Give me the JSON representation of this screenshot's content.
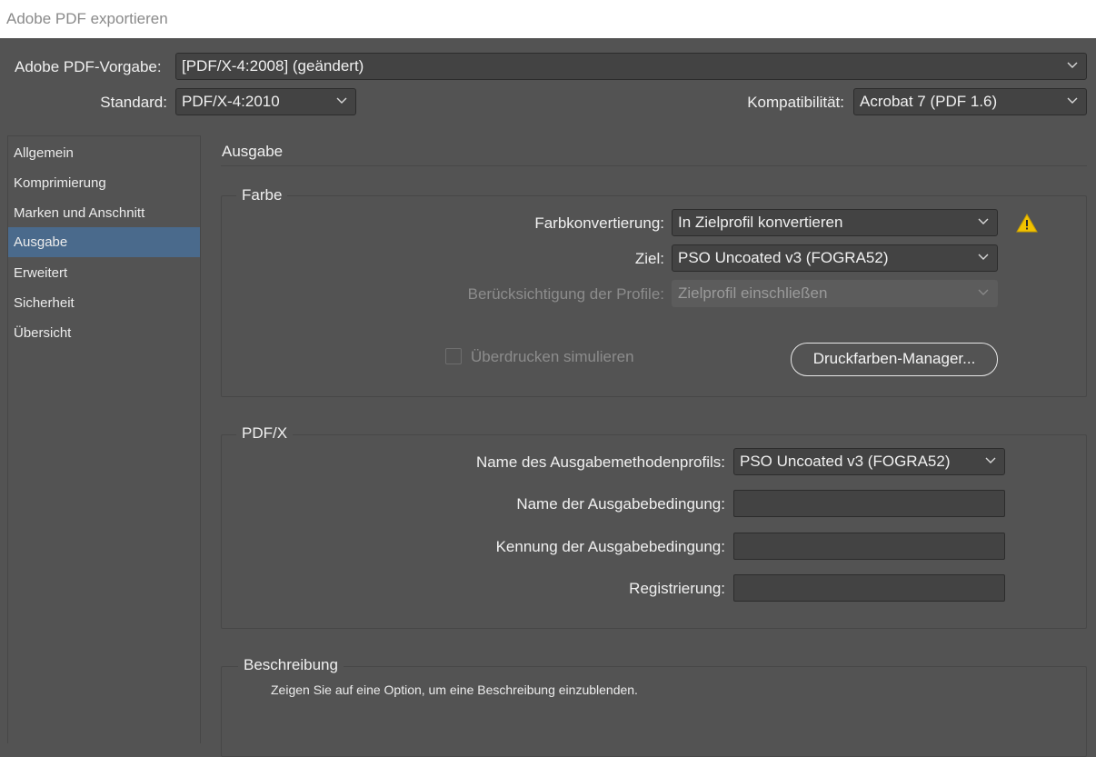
{
  "window": {
    "title": "Adobe PDF exportieren"
  },
  "top": {
    "preset_label": "Adobe PDF-Vorgabe:",
    "preset_value": "[PDF/X-4:2008] (geändert)",
    "standard_label": "Standard:",
    "standard_value": "PDF/X-4:2010",
    "compat_label": "Kompatibilität:",
    "compat_value": "Acrobat 7 (PDF 1.6)"
  },
  "sidebar": {
    "items": [
      {
        "label": "Allgemein"
      },
      {
        "label": "Komprimierung"
      },
      {
        "label": "Marken und Anschnitt"
      },
      {
        "label": "Ausgabe"
      },
      {
        "label": "Erweitert"
      },
      {
        "label": "Sicherheit"
      },
      {
        "label": "Übersicht"
      }
    ],
    "active_index": 3,
    "active_color": "#4a6a8c"
  },
  "main": {
    "title": "Ausgabe",
    "farbe": {
      "legend": "Farbe",
      "conversion_label": "Farbkonvertierung:",
      "conversion_value": "In Zielprofil konvertieren",
      "target_label": "Ziel:",
      "target_value": "PSO Uncoated v3 (FOGRA52)",
      "profile_label": "Berücksichtigung der Profile:",
      "profile_value": "Zielprofil einschließen",
      "overprint_label": "Überdrucken simulieren",
      "overprint_checked": false,
      "ink_manager_button": "Druckfarben-Manager...",
      "warning_icon": "warning-icon",
      "warning_color": "#f2c200"
    },
    "pdfx": {
      "legend": "PDF/X",
      "profile_name_label": "Name des Ausgabemethodenprofils:",
      "profile_name_value": "PSO Uncoated v3 (FOGRA52)",
      "condition_name_label": "Name der Ausgabebedingung:",
      "condition_name_value": "",
      "condition_id_label": "Kennung der Ausgabebedingung:",
      "condition_id_value": "",
      "registry_label": "Registrierung:",
      "registry_value": ""
    },
    "description": {
      "legend": "Beschreibung",
      "text": "Zeigen Sie auf eine Option, um eine Beschreibung einzublenden."
    }
  }
}
